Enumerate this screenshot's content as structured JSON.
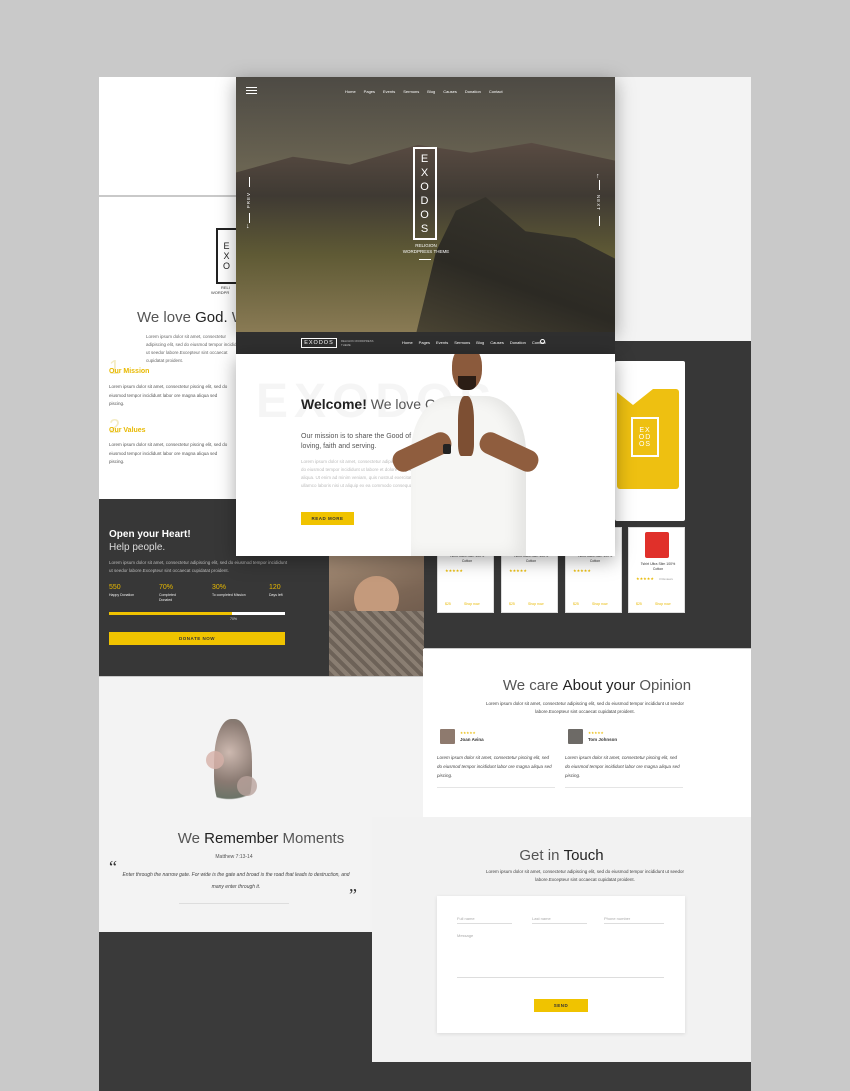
{
  "nav": {
    "items": [
      "Home",
      "Pages",
      "Events",
      "Sermons",
      "Blog",
      "Causes",
      "Donation",
      "Contact"
    ]
  },
  "hero": {
    "logo_letters": [
      "E",
      "X",
      "O",
      "D",
      "O",
      "S"
    ],
    "tag1": "RELIGION",
    "tag2": "WORDPRESS THEME",
    "prev": "PREV",
    "next": "NEXT"
  },
  "nav2": {
    "logo": "EXODOS",
    "tagline": "RELIGION WORDPRESS THEME",
    "items": [
      "Home",
      "Pages",
      "Events",
      "Sermons",
      "Blog",
      "Causes",
      "Donation",
      "Contact"
    ]
  },
  "welcome": {
    "bg_word": "EXODOS",
    "title_bold": "Welcome!",
    "title_light": " We love God.",
    "mission_text": "Our mission is to share the Good of Jesus Christ, loving, faith and serving.",
    "body_text": "Lorem ipsum dolor sit amet, consectetur adipiscing elit, sed do eiusmod tempor incididunt ut labore et dolore magna aliqua. Ut enim ad minim veniam, quis nostrud exercitation ullamco laboris nisi ut aliquip ex ea commodo consequat.",
    "button": "READ MORE"
  },
  "left_about": {
    "logo_letters": [
      "E",
      "X",
      "O",
      "O"
    ],
    "tag1": "RELI",
    "tag2": "WORDPR",
    "title_light": "We love ",
    "title_bold": "God.",
    "title_trail": " W",
    "intro": "Lorem ipsum dolor sit amet, consectetur adipiscing elit, sed do eiusmod tempor incididunt ut seedor labore.Excepteur sint occaecat cupidatat proident.",
    "mission_num": "1",
    "mission_title": "Our Mission",
    "mission_text": "Lorem ipsum dolor sit amet, consectetur piscing elit, sed do eiusmod tempor incididunt labor ore magna aliqua sed piscing.",
    "values_num": "2",
    "values_title": "Our Values",
    "values_text": "Lorem ipsum dolor sit amet, consectetur piscing elit, sed do eiusmod tempor incididunt labor ore magna aliqua sed piscing."
  },
  "donate": {
    "title": "Open your Heart!",
    "subtitle": "Help people.",
    "text": "Lorem ipsum dolor sit amet, consectetur adipiscing elit, sed do eiusmod tempor incididunt ut seedor labore.Excepteur sint occaecat cupidatat proident.",
    "stats": [
      {
        "value": "550",
        "label": "Happy Donation"
      },
      {
        "value": "70%",
        "label": "Completed Donated"
      },
      {
        "value": "30%",
        "label": "To completed Mission"
      },
      {
        "value": "120",
        "label": "Days left"
      }
    ],
    "progress_label": "70%",
    "progress": 0.7,
    "button": "DONATE NOW"
  },
  "shop": {
    "big_logo": [
      "EX",
      "OD",
      "OS"
    ],
    "products": [
      {
        "name": "Tshirt Ultra Slim 100% Cotton",
        "price": "$25",
        "color": "#444444",
        "reviews": "3 Reviews",
        "link": "Shop now"
      },
      {
        "name": "Tshirt Ultra Slim 100% Cotton",
        "price": "$25",
        "color": "#1d3b6b",
        "reviews": "3 Reviews",
        "link": "Shop now"
      },
      {
        "name": "Tshirt Ultra Slim 100% Cotton",
        "price": "$25",
        "color": "#1f7fd0",
        "reviews": "3 Reviews",
        "link": "Shop now"
      },
      {
        "name": "Tshirt Ultra Slim 100% Cotton",
        "price": "$25",
        "color": "#e0302a",
        "reviews": "3 Reviews",
        "link": "Shop now"
      }
    ]
  },
  "opinion": {
    "title_light1": "We care ",
    "title_bold": "About your",
    "title_light2": " Opinion",
    "intro": "Lorem ipsum dolor sit amet, consectetur adipiscing elit, sed do eiusmod tempor incididunt ut seedor labore.Excepteur sint occaecat cupidatat proident.",
    "reviews": [
      {
        "name": "Joan Avina",
        "text": "Lorem ipsum dolor sit amet, consectetur piscing elit, sed do eiusmod tempor incididunt labor ore magna aliqua sed piscing."
      },
      {
        "name": "Tom Johnson",
        "text": "Lorem ipsum dolor sit amet, consectetur piscing elit, sed do eiusmod tempor incididunt labor ore magna aliqua sed piscing."
      }
    ]
  },
  "remember": {
    "title_light1": "We ",
    "title_bold": "Remember",
    "title_light2": " Moments",
    "ref": "Matthew 7:13-14",
    "open_quote": "“",
    "close_quote": "”",
    "quote": "Enter through the narrow gate. For wide is the gate and broad is the road that leads to destruction, and many enter through it."
  },
  "contact": {
    "title_light": "Get in ",
    "title_bold": "Touch",
    "intro": "Lorem ipsum dolor sit amet, consectetur adipiscing elit, sed do eiusmod tempor incididunt ut seedor labore.Excepteur sint occaecat cupidatat proident.",
    "fields": [
      "Full name",
      "Last name",
      "Phone number"
    ],
    "message": "Message",
    "button": "SEND"
  },
  "colors": {
    "accent": "#f0c300",
    "dark": "#373737"
  }
}
